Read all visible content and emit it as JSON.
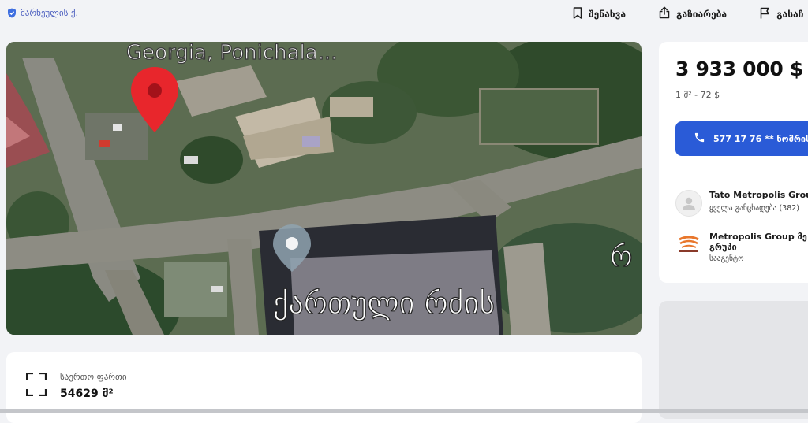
{
  "header": {
    "location": "მარნეულის ქ.",
    "actions": {
      "save_label": "შენახვა",
      "share_label": "გაზიარება",
      "report_label": "გასაჩ"
    }
  },
  "map": {
    "labels": {
      "top": "Georgia, Ponichala...",
      "bottom": "ქართული რძის",
      "right": "რ"
    }
  },
  "listing": {
    "price": "3 933 000 $",
    "unit_price": "1 მ² - 72 $",
    "phone_button_label": "577 17 76 ** ნომრის",
    "area_label": "საერთო ფართი",
    "area_value": "54629 მ²"
  },
  "agents": [
    {
      "name": "Tato Metropolis Group",
      "sub": "ყველა განცხადება (382)"
    },
    {
      "name_line1": "Metropolis Group მე",
      "name_line2": "გრუპი",
      "sub": "სააგენტო"
    }
  ],
  "colors": {
    "accent": "#2a5bd7",
    "location_pin": "#3f6fe0",
    "map_marker": "#e8262c"
  }
}
